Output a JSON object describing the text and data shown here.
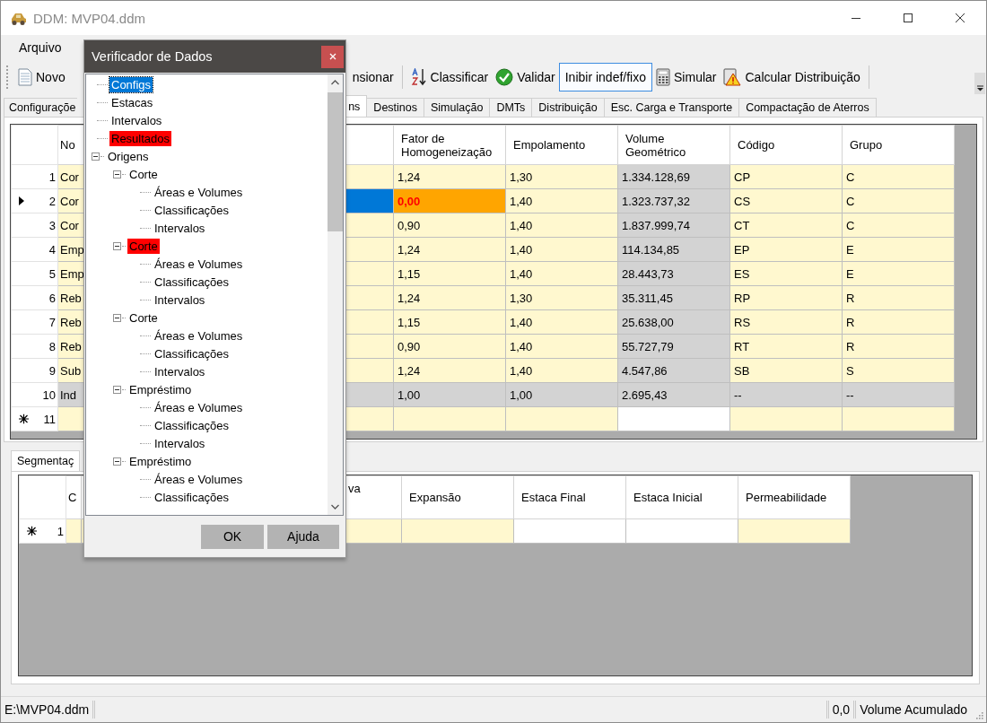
{
  "window": {
    "title": "DDM: MVP04.ddm"
  },
  "menu": [
    "Arquivo"
  ],
  "toolbar": [
    {
      "label": "Novo",
      "kind": "document",
      "checked": false
    },
    {
      "label": "nsionar",
      "kind": "text",
      "checked": false
    },
    {
      "kind": "separator"
    },
    {
      "label": "Classificar",
      "kind": "sort",
      "checked": false
    },
    {
      "label": "Validar",
      "kind": "check",
      "checked": false
    },
    {
      "label": "Inibir indef/fixo",
      "kind": "text",
      "checked": true
    },
    {
      "label": "Simular",
      "kind": "calculator",
      "checked": false
    },
    {
      "label": "Calcular Distribuição",
      "kind": "warning",
      "checked": false
    },
    {
      "kind": "separator"
    }
  ],
  "tabs": [
    {
      "label": "Configuraçõe",
      "selected": false
    },
    {
      "label": "ns",
      "selected": true
    },
    {
      "label": "Destinos",
      "selected": false
    },
    {
      "label": "Simulação",
      "selected": false
    },
    {
      "label": "DMTs",
      "selected": false
    },
    {
      "label": "Distribuição",
      "selected": false
    },
    {
      "label": "Esc. Carga e Transporte",
      "selected": false
    },
    {
      "label": "Compactação de Aterros",
      "selected": false
    }
  ],
  "main_grid": {
    "columns": [
      {
        "label": "No",
        "kind": "input",
        "validated": false
      },
      {
        "label": "Fator de Homogeneização",
        "kind": "input",
        "validated": true
      },
      {
        "label": "Empolamento",
        "kind": "input",
        "validated": false
      },
      {
        "label": "Volume Geométrico",
        "kind": "computed",
        "validated": false
      },
      {
        "label": "Código",
        "kind": "input",
        "validated": false
      },
      {
        "label": "Grupo",
        "kind": "input",
        "validated": false
      }
    ],
    "rows": [
      {
        "number": "1",
        "current": false,
        "new": false,
        "selected": false,
        "readonly": false,
        "invalid": false,
        "cells": [
          "Cor",
          "1,24",
          "1,30",
          "1.334.128,69",
          "CP",
          "C"
        ]
      },
      {
        "number": "2",
        "current": true,
        "new": false,
        "selected": true,
        "readonly": false,
        "invalid": true,
        "cells": [
          "Cor",
          "0,00",
          "1,40",
          "1.323.737,32",
          "CS",
          "C"
        ]
      },
      {
        "number": "3",
        "current": false,
        "new": false,
        "selected": false,
        "readonly": false,
        "invalid": false,
        "cells": [
          "Cor",
          "0,90",
          "1,40",
          "1.837.999,74",
          "CT",
          "C"
        ]
      },
      {
        "number": "4",
        "current": false,
        "new": false,
        "selected": false,
        "readonly": false,
        "invalid": false,
        "cells": [
          "Emp",
          "1,24",
          "1,40",
          "114.134,85",
          "EP",
          "E"
        ]
      },
      {
        "number": "5",
        "current": false,
        "new": false,
        "selected": false,
        "readonly": false,
        "invalid": false,
        "cells": [
          "Emp",
          "1,15",
          "1,40",
          "28.443,73",
          "ES",
          "E"
        ]
      },
      {
        "number": "6",
        "current": false,
        "new": false,
        "selected": false,
        "readonly": false,
        "invalid": false,
        "cells": [
          "Reb",
          "1,24",
          "1,30",
          "35.311,45",
          "RP",
          "R"
        ]
      },
      {
        "number": "7",
        "current": false,
        "new": false,
        "selected": false,
        "readonly": false,
        "invalid": false,
        "cells": [
          "Reb",
          "1,15",
          "1,40",
          "25.638,00",
          "RS",
          "R"
        ]
      },
      {
        "number": "8",
        "current": false,
        "new": false,
        "selected": false,
        "readonly": false,
        "invalid": false,
        "cells": [
          "Reb",
          "0,90",
          "1,40",
          "55.727,79",
          "RT",
          "R"
        ]
      },
      {
        "number": "9",
        "current": false,
        "new": false,
        "selected": false,
        "readonly": false,
        "invalid": false,
        "cells": [
          "Sub",
          "1,24",
          "1,40",
          "4.547,86",
          "SB",
          "S"
        ]
      },
      {
        "number": "10",
        "current": false,
        "new": false,
        "selected": false,
        "readonly": true,
        "invalid": false,
        "cells": [
          "Ind",
          "1,00",
          "1,00",
          "2.695,43",
          "--",
          "--"
        ]
      },
      {
        "number": "11",
        "current": false,
        "new": true,
        "selected": false,
        "readonly": false,
        "invalid": false,
        "cells": []
      }
    ]
  },
  "segment_grid": {
    "tab": {
      "label": "Segmentaç",
      "selected": true
    },
    "columns": [
      {
        "label": "C",
        "kind": "input"
      },
      {
        "label": "va",
        "kind": "input"
      },
      {
        "label": "Expansão",
        "kind": "input"
      },
      {
        "label": "Estaca Final",
        "kind": "plain"
      },
      {
        "label": "Estaca Inicial",
        "kind": "plain"
      },
      {
        "label": "Permeabilidade",
        "kind": "input"
      }
    ],
    "rows": [
      {
        "number": "1",
        "new": true
      }
    ]
  },
  "status_bar": [
    "E:\\MVP04.ddm",
    "0,0",
    "Volume Acumulado"
  ],
  "dialog": {
    "title": "Verificador de Dados",
    "tree": [
      {
        "label": "Configs",
        "selected": true,
        "flagged": false
      },
      {
        "label": "Estacas",
        "selected": false,
        "flagged": false
      },
      {
        "label": "Intervalos",
        "selected": false,
        "flagged": false
      },
      {
        "label": "Resultados",
        "selected": false,
        "flagged": true
      },
      {
        "label": "Origens",
        "selected": false,
        "flagged": false,
        "expanded": true,
        "children": [
          {
            "label": "Corte",
            "selected": false,
            "flagged": false,
            "expanded": true,
            "children": [
              {
                "label": "Áreas e Volumes",
                "selected": false,
                "flagged": false
              },
              {
                "label": "Classificações",
                "selected": false,
                "flagged": false
              },
              {
                "label": "Intervalos",
                "selected": false,
                "flagged": false
              }
            ]
          },
          {
            "label": "Corte",
            "selected": false,
            "flagged": true,
            "expanded": true,
            "children": [
              {
                "label": "Áreas e Volumes",
                "selected": false,
                "flagged": false
              },
              {
                "label": "Classificações",
                "selected": false,
                "flagged": false
              },
              {
                "label": "Intervalos",
                "selected": false,
                "flagged": false
              }
            ]
          },
          {
            "label": "Corte",
            "selected": false,
            "flagged": false,
            "expanded": true,
            "children": [
              {
                "label": "Áreas e Volumes",
                "selected": false,
                "flagged": false
              },
              {
                "label": "Classificações",
                "selected": false,
                "flagged": false
              },
              {
                "label": "Intervalos",
                "selected": false,
                "flagged": false
              }
            ]
          },
          {
            "label": "Empréstimo",
            "selected": false,
            "flagged": false,
            "expanded": true,
            "children": [
              {
                "label": "Áreas e Volumes",
                "selected": false,
                "flagged": false
              },
              {
                "label": "Classificações",
                "selected": false,
                "flagged": false
              },
              {
                "label": "Intervalos",
                "selected": false,
                "flagged": false
              }
            ]
          },
          {
            "label": "Empréstimo",
            "selected": false,
            "flagged": false,
            "expanded": true,
            "children": [
              {
                "label": "Áreas e Volumes",
                "selected": false,
                "flagged": false
              },
              {
                "label": "Classificações",
                "selected": false,
                "flagged": false
              }
            ]
          }
        ]
      }
    ],
    "buttons": [
      "OK",
      "Ajuda"
    ]
  }
}
